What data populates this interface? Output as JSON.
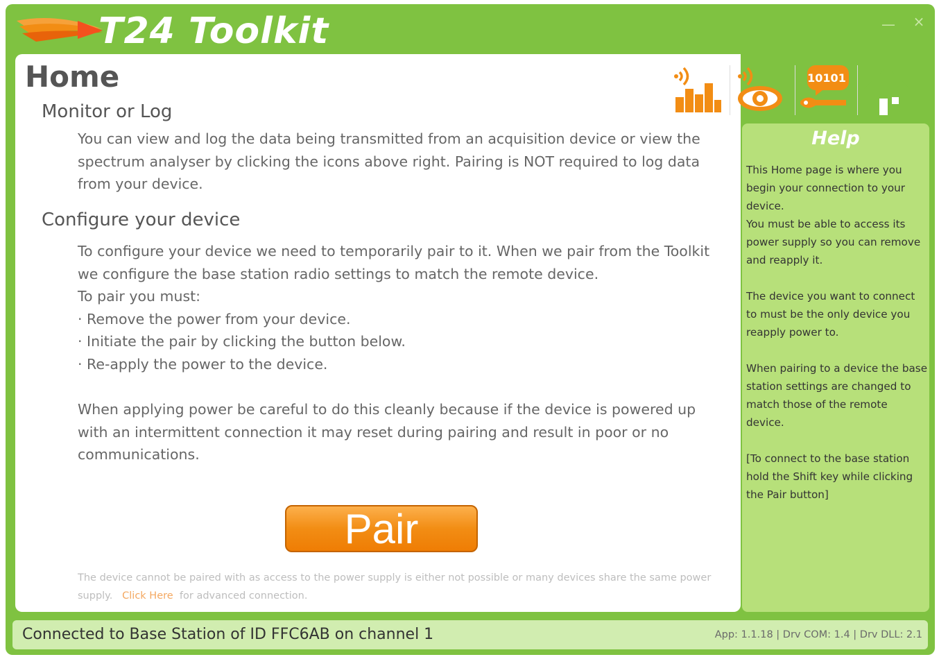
{
  "window": {
    "title": "T24 Toolkit",
    "minimize_glyph": "—",
    "close_glyph": "×",
    "accent_color": "#7fc241",
    "orange_color": "#f28d14"
  },
  "toolbar": {
    "icons": [
      {
        "name": "log-data-icon"
      },
      {
        "name": "spectrum-view-icon"
      },
      {
        "name": "configure-icon",
        "label": "10101"
      },
      {
        "name": "home-icon"
      }
    ]
  },
  "page": {
    "title": "Home",
    "monitor": {
      "heading": "Monitor or Log",
      "text": "You can view and log the data being transmitted from an acquisition device or view the spectrum analyser by clicking the icons above right. Pairing is NOT required to log data from your device."
    },
    "configure": {
      "heading": "Configure your device",
      "intro": "To configure your device we need to temporarily pair to it. When we pair from the Toolkit we configure the base station radio settings to match the remote device.",
      "must": "To pair you must:",
      "steps": [
        "· Remove the power from your device.",
        "· Initiate the pair by clicking the button below.",
        "· Re-apply the power to the device."
      ],
      "warning": "When applying power be careful to do this cleanly because if the device is powered up with an intermittent connection it may reset during pairing and result in poor or no communications."
    },
    "pair_button": "Pair",
    "note": {
      "before": "The device cannot be paired with as access to the power supply is either not possible or many devices share the same power supply.",
      "link": "Click Here",
      "after": "for advanced connection."
    }
  },
  "help": {
    "title": "Help",
    "paragraphs": [
      "This Home page is where you begin your connection to your device.\n You must be able to access its power supply so you can remove and reapply it.",
      " The device you want to connect to must be the only device you reapply power to.",
      "When pairing to a device the base station settings are changed to match those of the remote device.",
      "[To connect to the base station hold the Shift key while clicking the Pair button]"
    ]
  },
  "status": {
    "connection": "Connected to Base Station of ID FFC6AB on channel 1",
    "version": "App: 1.1.18 | Drv COM: 1.4 | Drv DLL: 2.1"
  }
}
